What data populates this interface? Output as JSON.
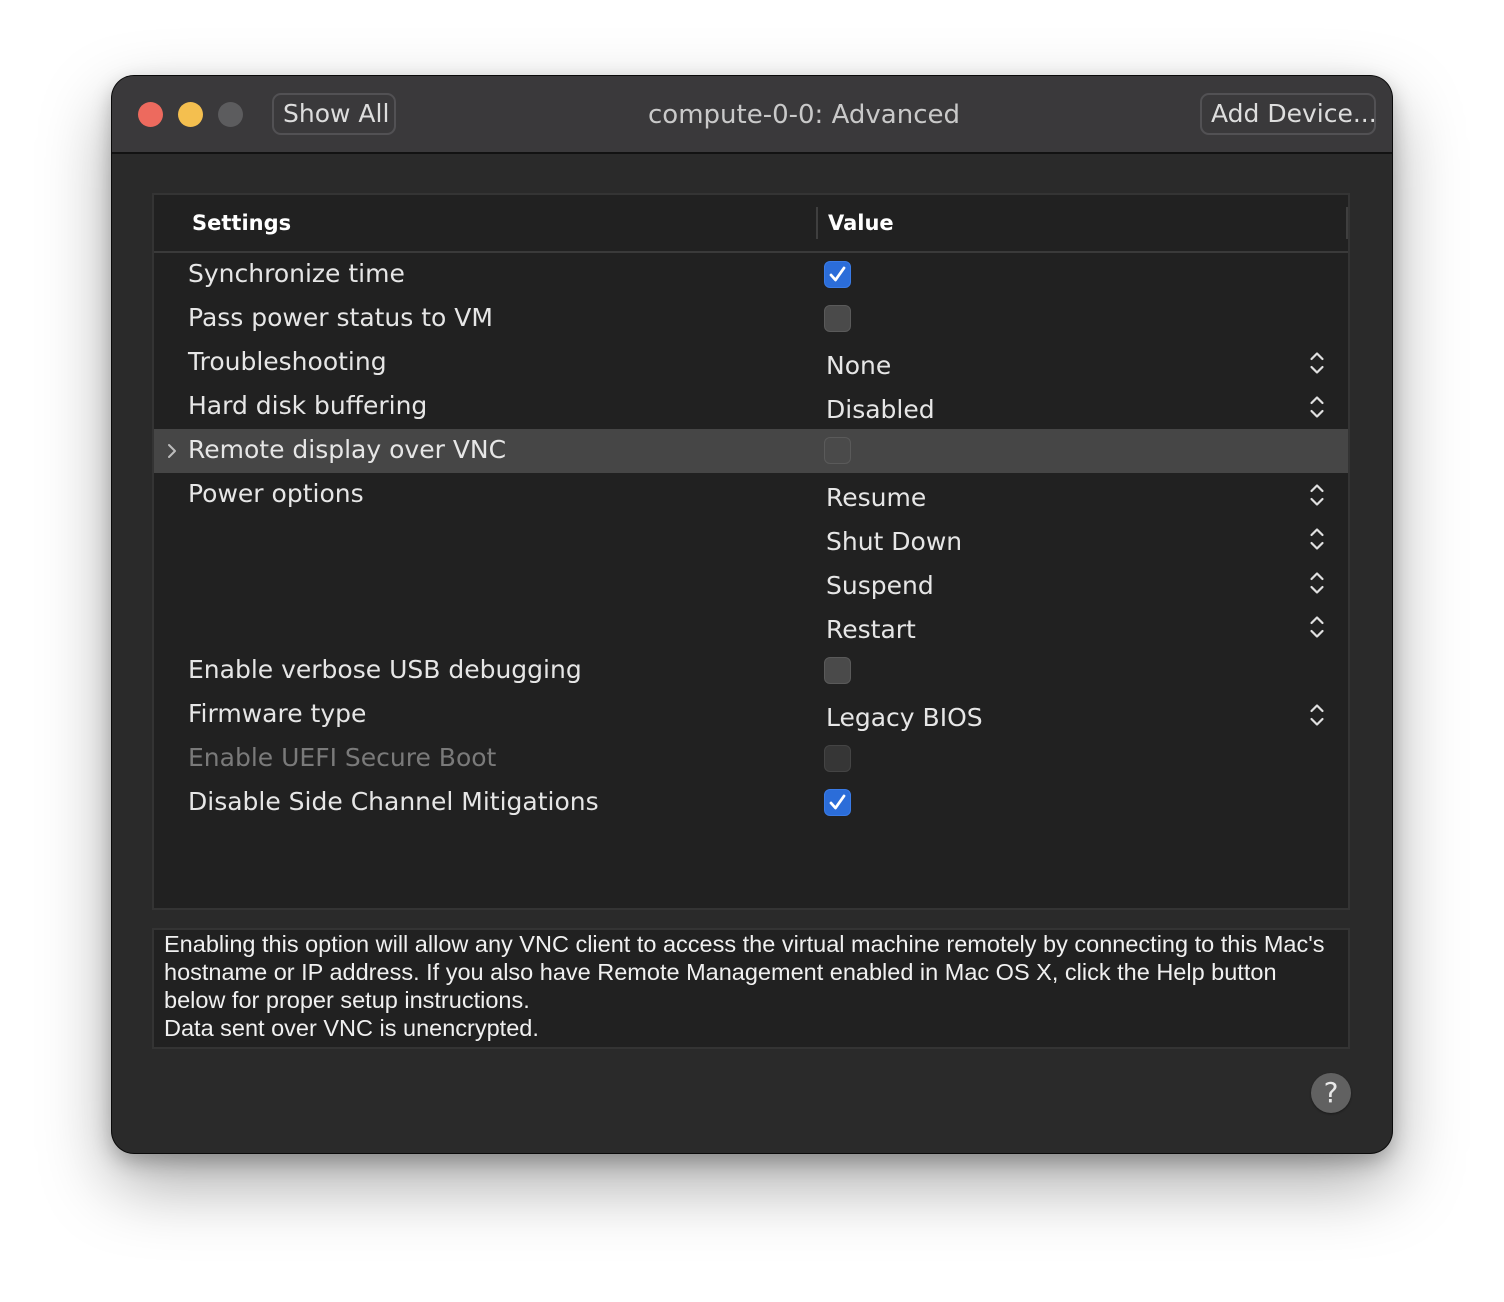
{
  "window": {
    "title": "compute-0-0: Advanced",
    "show_all_label": "Show All",
    "add_device_label": "Add Device..."
  },
  "table": {
    "columns": [
      "Settings",
      "Value"
    ],
    "rows": [
      {
        "label": "Synchronize time",
        "type": "checkbox",
        "checked": true
      },
      {
        "label": "Pass power status to VM",
        "type": "checkbox",
        "checked": false
      },
      {
        "label": "Troubleshooting",
        "type": "popup",
        "value": "None"
      },
      {
        "label": "Hard disk buffering",
        "type": "popup",
        "value": "Disabled"
      },
      {
        "label": "Remote display over VNC",
        "type": "checkbox",
        "checked": false,
        "selected": true,
        "expandable": true
      },
      {
        "label": "Power options",
        "type": "popup",
        "value": "Resume"
      },
      {
        "label": "",
        "type": "popup",
        "value": "Shut Down"
      },
      {
        "label": "",
        "type": "popup",
        "value": "Suspend"
      },
      {
        "label": "",
        "type": "popup",
        "value": "Restart"
      },
      {
        "label": "Enable verbose USB debugging",
        "type": "checkbox",
        "checked": false
      },
      {
        "label": "Firmware type",
        "type": "popup",
        "value": "Legacy BIOS"
      },
      {
        "label": "Enable UEFI Secure Boot",
        "type": "checkbox",
        "checked": false,
        "disabled": true
      },
      {
        "label": "Disable Side Channel Mitigations",
        "type": "checkbox",
        "checked": true
      }
    ]
  },
  "description": {
    "line1": "Enabling this option will allow any VNC client to access the virtual machine remotely by connecting to this Mac's hostname or IP address. If you also have Remote Management enabled in Mac OS X, click the Help button below for proper setup instructions.",
    "line2": "Data sent over VNC is unencrypted."
  },
  "help_label": "?",
  "colors": {
    "checkbox_checked": "#2b6dd9",
    "selected_row": "#464646",
    "close": "#ed6a5e",
    "minimize": "#f4bf4f",
    "zoom": "#5c5c5e"
  }
}
